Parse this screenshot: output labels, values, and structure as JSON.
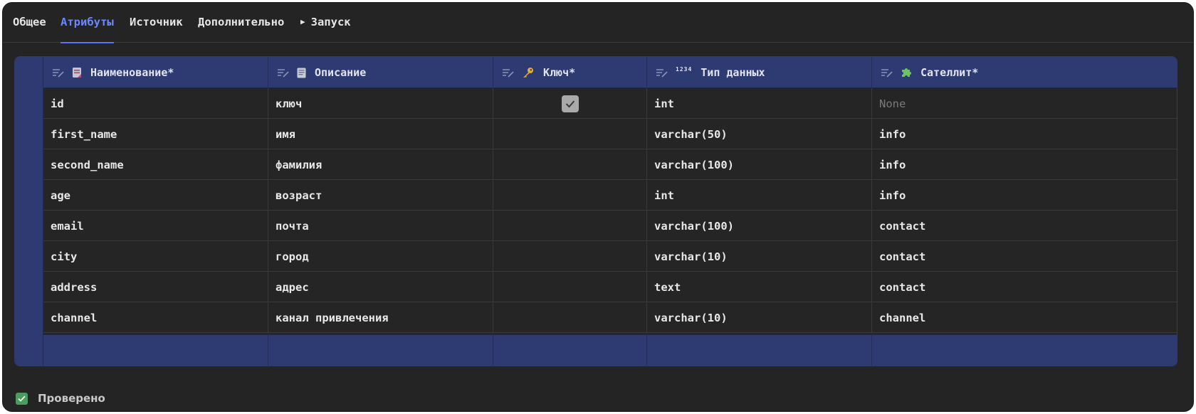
{
  "tabs": [
    {
      "label": "Общее"
    },
    {
      "label": "Атрибуты"
    },
    {
      "label": "Источник"
    },
    {
      "label": "Дополнительно"
    },
    {
      "label": "Запуск",
      "icon": "play-icon"
    }
  ],
  "active_tab": "Атрибуты",
  "columns": [
    {
      "label": "Наименование*",
      "icon": "document-icon"
    },
    {
      "label": "Описание",
      "icon": "note-icon"
    },
    {
      "label": "Ключ*",
      "icon": "key-icon"
    },
    {
      "label": "Тип данных",
      "icon": "numbers-icon",
      "icon_text": "1234"
    },
    {
      "label": "Сателлит*",
      "icon": "puzzle-icon"
    }
  ],
  "rows": [
    {
      "name": "id",
      "description": "ключ",
      "key": true,
      "type": "int",
      "satellite": "None"
    },
    {
      "name": "first_name",
      "description": "имя",
      "key": false,
      "type": "varchar(50)",
      "satellite": "info"
    },
    {
      "name": "second_name",
      "description": "фамилия",
      "key": false,
      "type": "varchar(100)",
      "satellite": "info"
    },
    {
      "name": "age",
      "description": "возраст",
      "key": false,
      "type": "int",
      "satellite": "info"
    },
    {
      "name": "email",
      "description": "почта",
      "key": false,
      "type": "varchar(100)",
      "satellite": "contact"
    },
    {
      "name": "city",
      "description": "город",
      "key": false,
      "type": "varchar(10)",
      "satellite": "contact"
    },
    {
      "name": "address",
      "description": "адрес",
      "key": false,
      "type": "text",
      "satellite": "contact"
    },
    {
      "name": "channel",
      "description": "канал привлечения",
      "key": false,
      "type": "varchar(10)",
      "satellite": "channel"
    }
  ],
  "status": {
    "label": "Проверено",
    "icon": "check-icon"
  },
  "colors": {
    "accent": "#6b86ff",
    "header_bg": "#2e3a72",
    "background": "#242424",
    "status_ok": "#4b9a5f"
  }
}
